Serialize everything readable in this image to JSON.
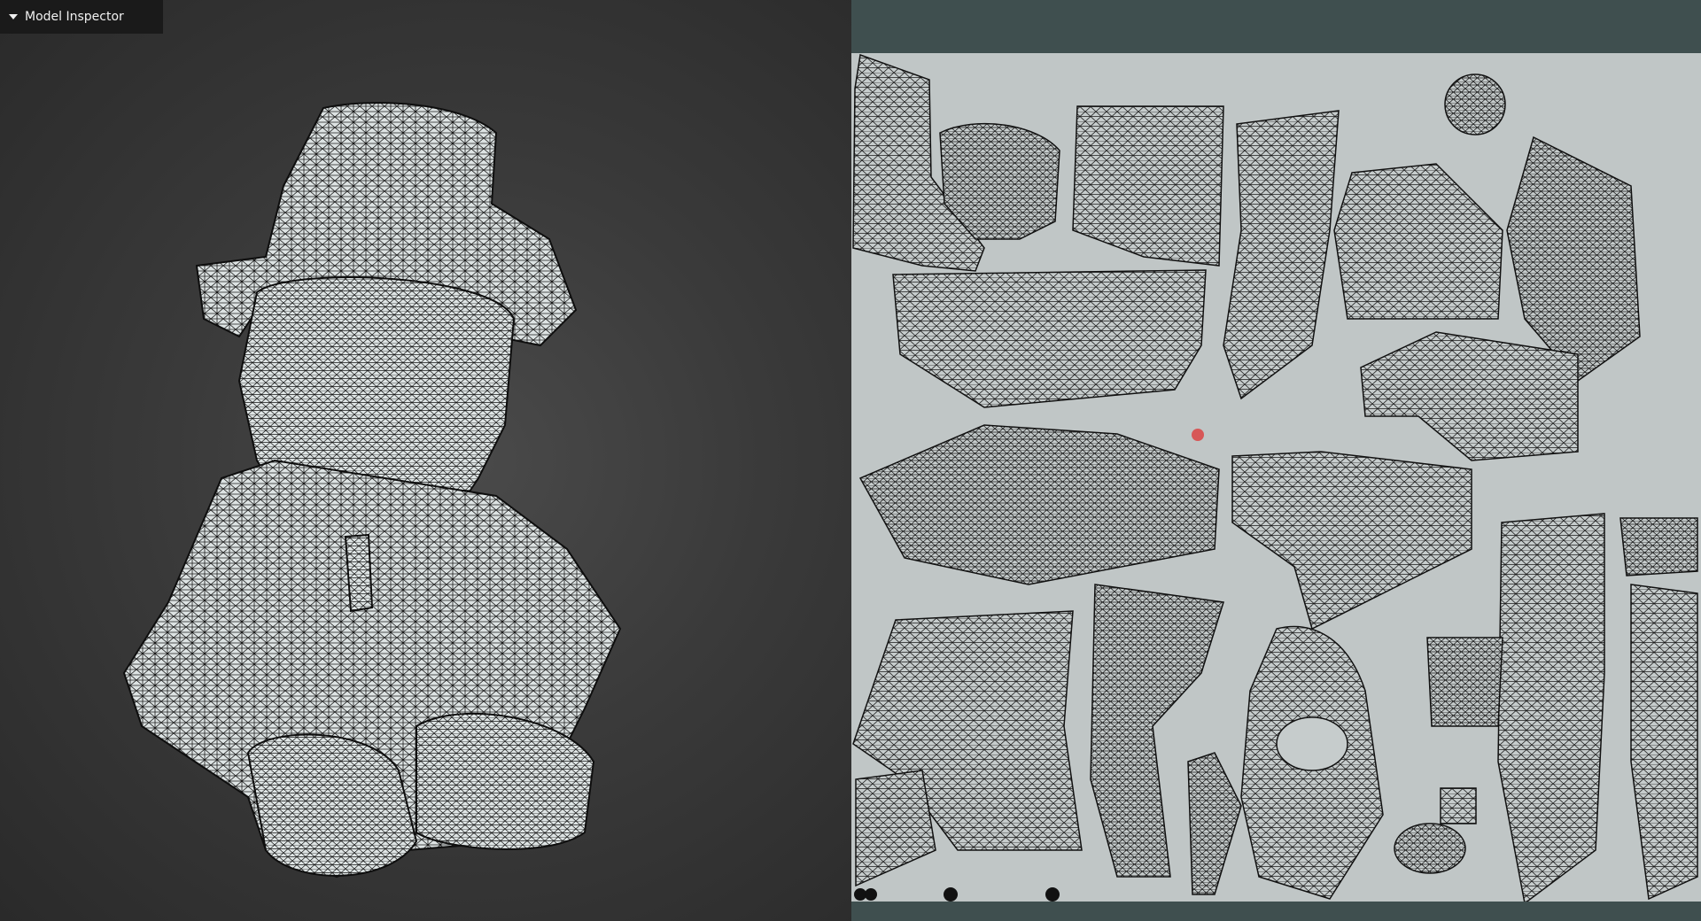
{
  "panel": {
    "title": "Model Inspector",
    "expanded": true
  },
  "colors": {
    "viewport_bg": "#3a3a3a",
    "uv_bg": "#c0c6c6",
    "uv_frame": "#3f4f4f",
    "mesh_fill": "#dde3e3",
    "wire": "#111111",
    "cursor": "#d94a4a"
  },
  "icons": {
    "disclosure": "triangle-down-icon"
  }
}
